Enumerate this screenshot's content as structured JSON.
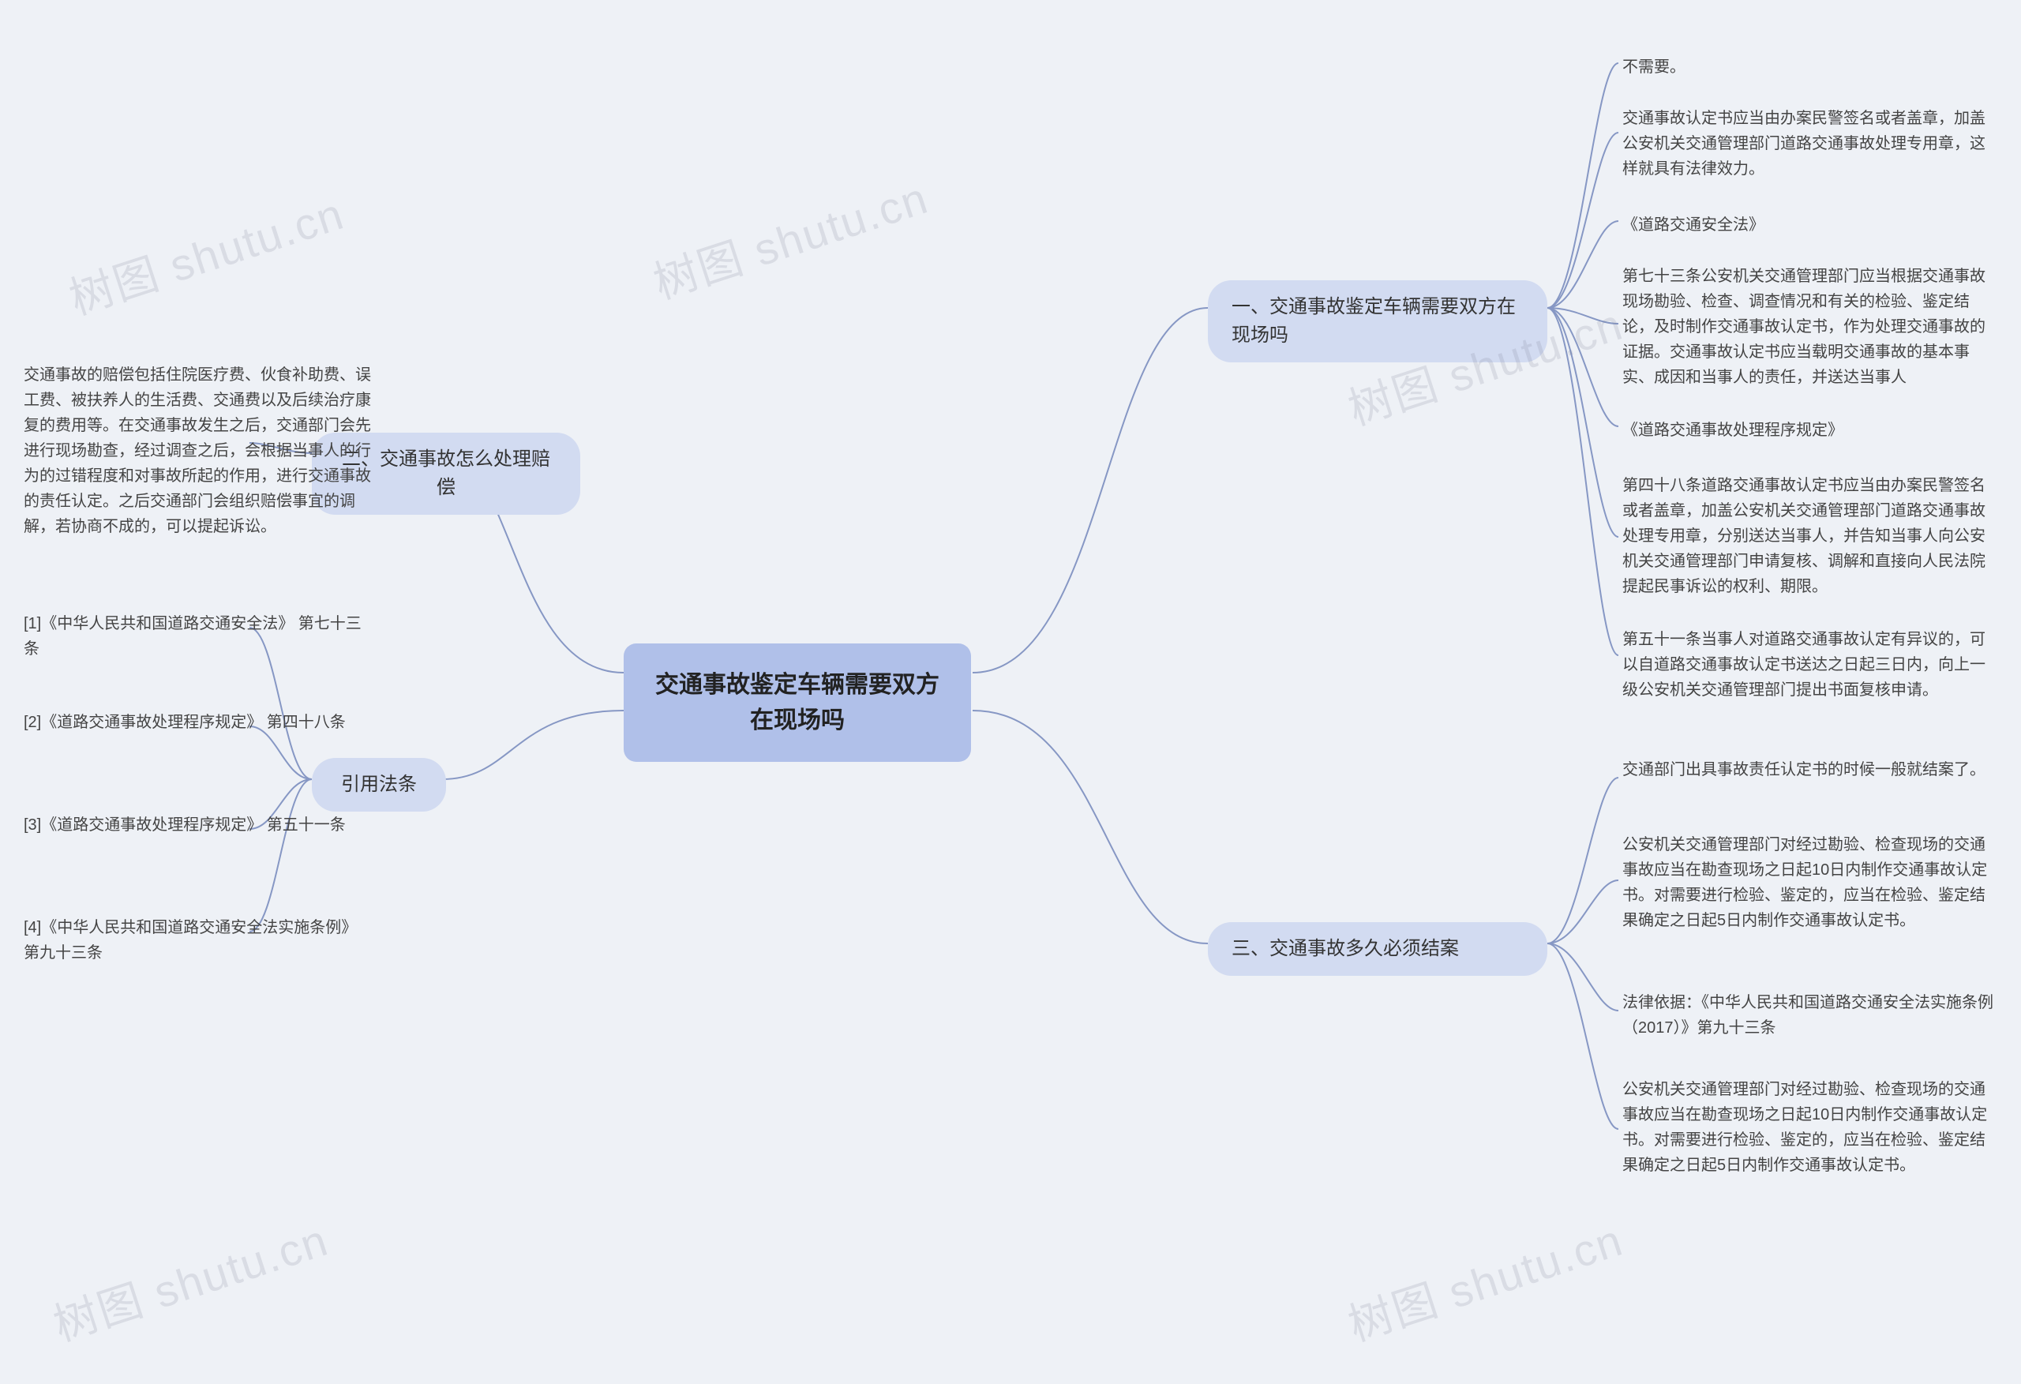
{
  "root": {
    "title": "交通事故鉴定车辆需要双方在现场吗"
  },
  "branches": {
    "b1": {
      "label": "一、交通事故鉴定车辆需要双方在现场吗"
    },
    "b2": {
      "label": "二、交通事故怎么处理赔偿"
    },
    "b3": {
      "label": "三、交通事故多久必须结案"
    },
    "b4": {
      "label": "引用法条"
    }
  },
  "leaves": {
    "b1_1": "不需要。",
    "b1_2": "交通事故认定书应当由办案民警签名或者盖章，加盖公安机关交通管理部门道路交通事故处理专用章，这样就具有法律效力。",
    "b1_3": "《道路交通安全法》",
    "b1_4": "第七十三条公安机关交通管理部门应当根据交通事故现场勘验、检查、调查情况和有关的检验、鉴定结论，及时制作交通事故认定书，作为处理交通事故的证据。交通事故认定书应当载明交通事故的基本事实、成因和当事人的责任，并送达当事人",
    "b1_5": "《道路交通事故处理程序规定》",
    "b1_6": "第四十八条道路交通事故认定书应当由办案民警签名或者盖章，加盖公安机关交通管理部门道路交通事故处理专用章，分别送达当事人，并告知当事人向公安机关交通管理部门申请复核、调解和直接向人民法院提起民事诉讼的权利、期限。",
    "b1_7": "第五十一条当事人对道路交通事故认定有异议的，可以自道路交通事故认定书送达之日起三日内，向上一级公安机关交通管理部门提出书面复核申请。",
    "b2_1": "交通事故的赔偿包括住院医疗费、伙食补助费、误工费、被扶养人的生活费、交通费以及后续治疗康复的费用等。在交通事故发生之后，交通部门会先进行现场勘查，经过调查之后，会根据当事人的行为的过错程度和对事故所起的作用，进行交通事故的责任认定。之后交通部门会组织赔偿事宜的调解，若协商不成的，可以提起诉讼。",
    "b3_1": "交通部门出具事故责任认定书的时候一般就结案了。",
    "b3_2": "公安机关交通管理部门对经过勘验、检查现场的交通事故应当在勘查现场之日起10日内制作交通事故认定书。对需要进行检验、鉴定的，应当在检验、鉴定结果确定之日起5日内制作交通事故认定书。",
    "b3_3": "法律依据：《中华人民共和国道路交通安全法实施条例（2017）》第九十三条",
    "b3_4": "公安机关交通管理部门对经过勘验、检查现场的交通事故应当在勘查现场之日起10日内制作交通事故认定书。对需要进行检验、鉴定的，应当在检验、鉴定结果确定之日起5日内制作交通事故认定书。",
    "b4_1": "[1]《中华人民共和国道路交通安全法》 第七十三条",
    "b4_2": "[2]《道路交通事故处理程序规定》 第四十八条",
    "b4_3": "[3]《道路交通事故处理程序规定》 第五十一条",
    "b4_4": "[4]《中华人民共和国道路交通安全法实施条例》 第九十三条"
  },
  "watermark": "树图 shutu.cn"
}
